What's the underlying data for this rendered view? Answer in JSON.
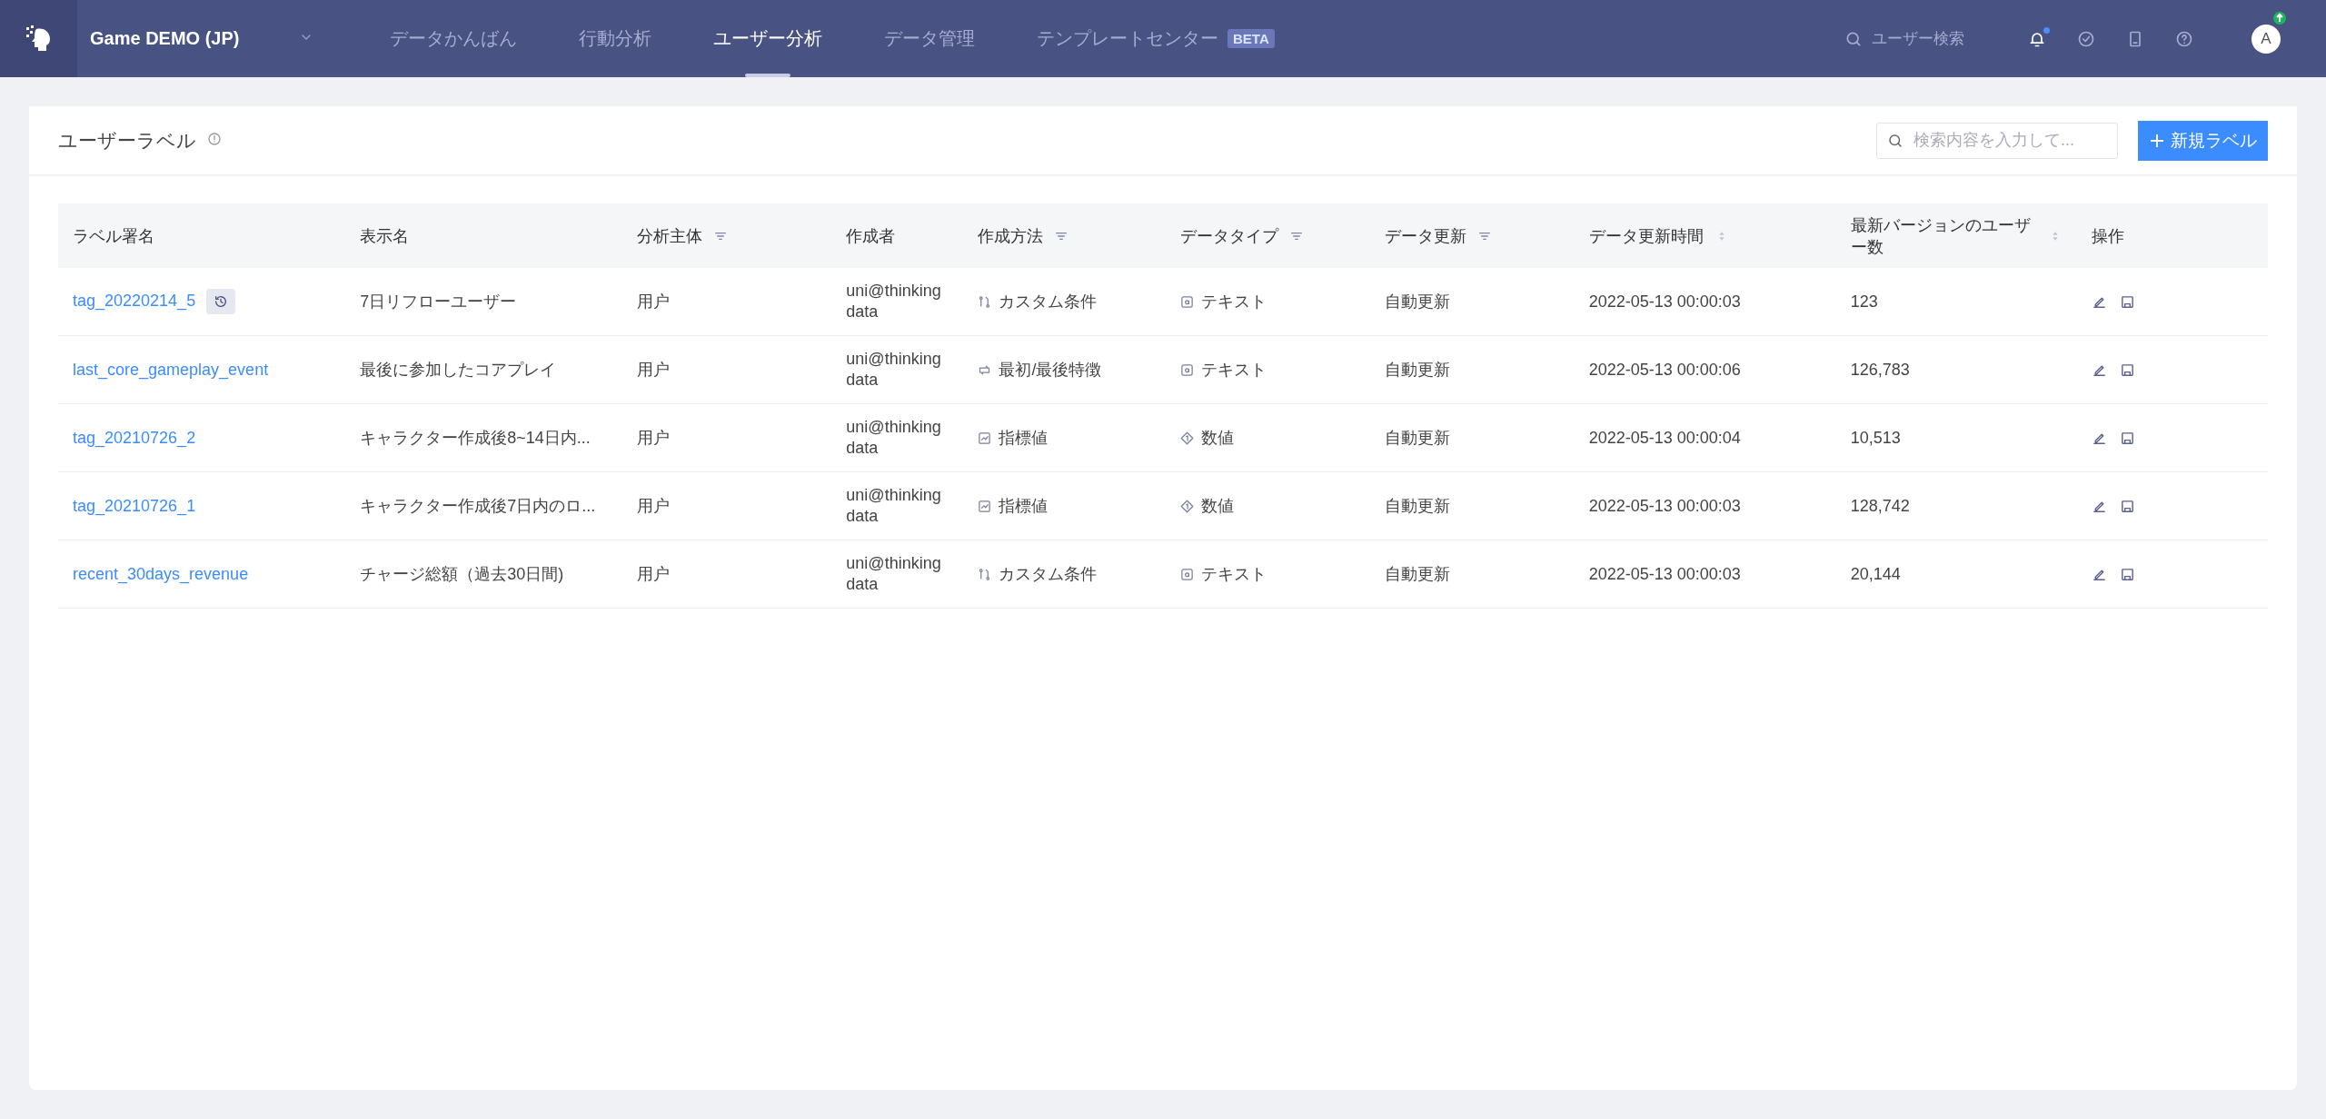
{
  "nav": {
    "project": "Game DEMO (JP)",
    "tabs": [
      {
        "label": "データかんばん",
        "selected": false
      },
      {
        "label": "行動分析",
        "selected": false
      },
      {
        "label": "ユーザー分析",
        "selected": true
      },
      {
        "label": "データ管理",
        "selected": false
      },
      {
        "label": "テンプレートセンター",
        "selected": false,
        "badge": "BETA"
      }
    ],
    "user_search": {
      "placeholder": "ユーザー検索"
    },
    "notifications_unread": true,
    "avatar": "A"
  },
  "page": {
    "title": "ユーザーラベル",
    "search": {
      "placeholder": "検索内容を入力して..."
    },
    "new_button": "新規ラベル"
  },
  "table": {
    "columns": [
      {
        "label": "ラベル署名",
        "filterable": false,
        "sortable": false
      },
      {
        "label": "表示名",
        "filterable": false,
        "sortable": false
      },
      {
        "label": "分析主体",
        "filterable": true,
        "sortable": false
      },
      {
        "label": "作成者",
        "filterable": false,
        "sortable": false
      },
      {
        "label": "作成方法",
        "filterable": true,
        "sortable": false
      },
      {
        "label": "データタイプ",
        "filterable": true,
        "sortable": false
      },
      {
        "label": "データ更新",
        "filterable": true,
        "sortable": false
      },
      {
        "label": "データ更新時間",
        "filterable": false,
        "sortable": true
      },
      {
        "label": "最新バージョンのユーザー数",
        "filterable": false,
        "sortable": true
      },
      {
        "label": "操作",
        "filterable": false,
        "sortable": false
      }
    ],
    "rows": [
      {
        "name": "tag_20220214_5",
        "history": true,
        "display": "7日リフローユーザー",
        "subject": "用户",
        "creator": "uni@thinkingdata",
        "method": {
          "kind": "custom",
          "label": "カスタム条件"
        },
        "data_type": {
          "kind": "text",
          "label": "テキスト"
        },
        "update": "自動更新",
        "time": "2022-05-13 00:00:03",
        "users": "123"
      },
      {
        "name": "last_core_gameplay_event",
        "history": false,
        "display": "最後に参加したコアプレイ",
        "subject": "用户",
        "creator": "uni@thinkingdata",
        "method": {
          "kind": "first_last",
          "label": "最初/最後特徴"
        },
        "data_type": {
          "kind": "text",
          "label": "テキスト"
        },
        "update": "自動更新",
        "time": "2022-05-13 00:00:06",
        "users": "126,783"
      },
      {
        "name": "tag_20210726_2",
        "history": false,
        "display": "キャラクター作成後8~14日内...",
        "subject": "用户",
        "creator": "uni@thinkingdata",
        "method": {
          "kind": "metric",
          "label": "指標値"
        },
        "data_type": {
          "kind": "number",
          "label": "数値"
        },
        "update": "自動更新",
        "time": "2022-05-13 00:00:04",
        "users": "10,513"
      },
      {
        "name": "tag_20210726_1",
        "history": false,
        "display": "キャラクター作成後7日内のロ...",
        "subject": "用户",
        "creator": "uni@thinkingdata",
        "method": {
          "kind": "metric",
          "label": "指標値"
        },
        "data_type": {
          "kind": "number",
          "label": "数値"
        },
        "update": "自動更新",
        "time": "2022-05-13 00:00:03",
        "users": "128,742"
      },
      {
        "name": "recent_30days_revenue",
        "history": false,
        "display": "チャージ総額（過去30日間)",
        "subject": "用户",
        "creator": "uni@thinkingdata",
        "method": {
          "kind": "custom",
          "label": "カスタム条件"
        },
        "data_type": {
          "kind": "text",
          "label": "テキスト"
        },
        "update": "自動更新",
        "time": "2022-05-13 00:00:03",
        "users": "20,144"
      }
    ]
  }
}
